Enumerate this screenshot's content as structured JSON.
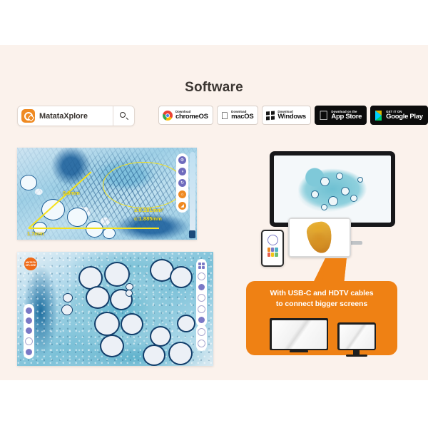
{
  "page": {
    "title": "Software",
    "background_color": "#fbf2ec",
    "accent_color": "#ef8114"
  },
  "search": {
    "logo_icon": "matataxplore-logo-icon",
    "app_name": "MatataXplore",
    "search_icon": "search-icon"
  },
  "download_badges": [
    {
      "pre": "Download",
      "main": "chromeOS",
      "icon": "chrome-icon",
      "style": "light"
    },
    {
      "pre": "Download",
      "main": "macOS",
      "icon": "apple-icon",
      "style": "light"
    },
    {
      "pre": "Download",
      "main": "Windows",
      "icon": "windows-icon",
      "style": "light"
    },
    {
      "pre": "Download on the",
      "main": "App Store",
      "icon": "apple-icon",
      "style": "dark"
    },
    {
      "pre": "GET IT ON",
      "main": "Google Play",
      "icon": "google-play-icon",
      "style": "dark"
    }
  ],
  "capture_card": {
    "measurements": {
      "diagonal_label": "0.9mm",
      "horizontal_label": "1.7mm",
      "area_label": "s:0.191mm²",
      "circumference_label": "c:1.885mm"
    },
    "annotation_color": "#f5e11c",
    "toolbar_icons": [
      "settings-icon",
      "contrast-icon",
      "rotate-icon",
      "brightness-icon",
      "measure-icon"
    ]
  },
  "gallery_card": {
    "badge_text": "MATATA\nXPLORE",
    "left_toolbar_icons": [
      "camera-icon",
      "photo-icon",
      "video-icon",
      "circle-icon",
      "settings-icon"
    ],
    "right_toolbar_icons": [
      "grid-icon",
      "focus-icon",
      "contrast-icon",
      "rotate-icon",
      "brightness-icon",
      "layers-icon"
    ],
    "right_toolbar_secondary_icons": [
      "zoom-in-icon",
      "zoom-out-icon"
    ]
  },
  "devices": {
    "monitor_icon": "desktop-monitor",
    "tablet_icon": "tablet-device",
    "phone_icon": "smartphone-device"
  },
  "callout": {
    "line1": "With USB-C and HDTV cables",
    "line2": "to connect bigger screens",
    "tv_large_icon": "tv-screen-icon",
    "tv_small_icon": "monitor-screen-icon"
  }
}
